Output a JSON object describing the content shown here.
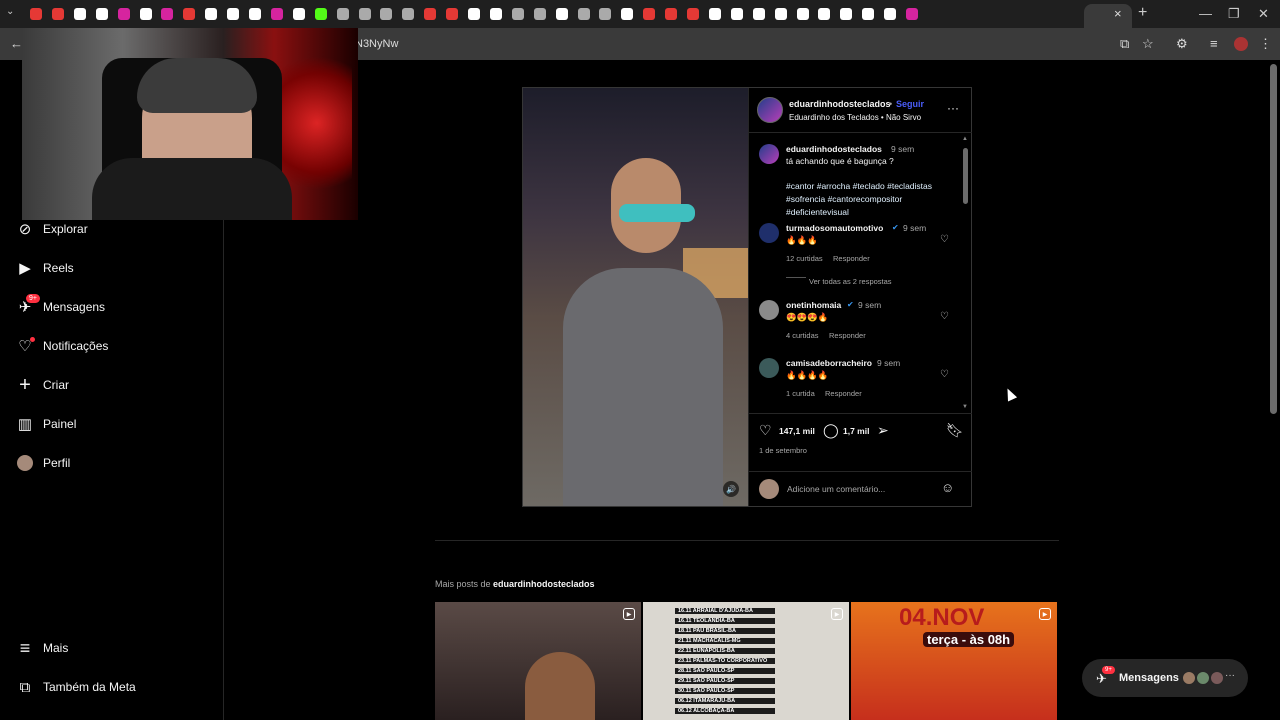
{
  "browser": {
    "url": "N3NyNw",
    "tab_menu": "⌄",
    "new_tab": "+",
    "tab_close": "×",
    "window_controls": [
      "—",
      "❐",
      "✕"
    ],
    "tab_favicons": [
      "#e53935",
      "#e53935",
      "#ffffff",
      "#ffffff",
      "#d6249f",
      "#ffffff",
      "#d6249f",
      "#e53935",
      "#ffffff",
      "#ffffff",
      "#ffffff",
      "#d6249f",
      "#ffffff",
      "#53fc18",
      "#aaaaaa",
      "#aaaaaa",
      "#aaaaaa",
      "#aaaaaa",
      "#e53935",
      "#e53935",
      "#ffffff",
      "#ffffff",
      "#aaaaaa",
      "#aaaaaa",
      "#ffffff",
      "#aaaaaa",
      "#aaaaaa",
      "#ffffff",
      "#e53935",
      "#e53935",
      "#e53935",
      "#ffffff",
      "#ffffff",
      "#ffffff",
      "#ffffff",
      "#ffffff",
      "#ffffff",
      "#ffffff",
      "#ffffff",
      "#ffffff",
      "#d6249f"
    ]
  },
  "sidebar": {
    "items": [
      {
        "icon": "compass-icon",
        "glyph": "⊘",
        "label": "Explorar"
      },
      {
        "icon": "reels-icon",
        "glyph": "▶",
        "label": "Reels"
      },
      {
        "icon": "messenger-icon",
        "glyph": "✈",
        "label": "Mensagens",
        "badge": "9+"
      },
      {
        "icon": "heart-icon",
        "glyph": "♡",
        "label": "Notificações"
      },
      {
        "icon": "plus-icon",
        "glyph": "+",
        "label": "Criar"
      },
      {
        "icon": "dashboard-icon",
        "glyph": "▥",
        "label": "Painel"
      },
      {
        "icon": "profile-avatar",
        "glyph": "",
        "label": "Perfil"
      }
    ],
    "more": {
      "glyph": "≡",
      "label": "Mais"
    },
    "meta": {
      "glyph": "⧉",
      "label": "Também da Meta"
    }
  },
  "post": {
    "username": "eduardinhodosteclados",
    "separator": "•",
    "follow": "Seguir",
    "audio": "Eduardinho dos Teclados • Não Sirvo",
    "more": "···",
    "sound_icon": "🔊",
    "caption": {
      "user": "eduardinhodosteclados",
      "time": "9 sem",
      "text": "tá achando que é bagunça ?",
      "tags": "#cantor #arrocha #teclado #tecladistas #sofrencia #cantorecompositor #deficientevisual"
    },
    "comments": [
      {
        "user": "turmadosomautomotivo",
        "verified": true,
        "time": "9 sem",
        "text": "🔥🔥🔥",
        "likes": "12 curtidas",
        "reply": "Responder",
        "replies": "Ver todas as 2 respostas",
        "avatar_color": "#1f2f6b"
      },
      {
        "user": "onetinhomaia",
        "verified": true,
        "time": "9 sem",
        "text": "😍😍😍🔥",
        "likes": "4 curtidas",
        "reply": "Responder",
        "avatar_color": "#8a8a8a"
      },
      {
        "user": "camisadeborracheiro",
        "verified": false,
        "time": "9 sem",
        "text": "🔥🔥🔥🔥",
        "likes": "1 curtida",
        "reply": "Responder",
        "avatar_color": "#3b5a5a"
      }
    ],
    "likes": "147,1 mil",
    "comment_count": "1,7 mil",
    "date": "1 de setembro",
    "comment_placeholder": "Adicione um comentário...",
    "emoji_icon": "☺"
  },
  "more_posts": {
    "prefix": "Mais posts de",
    "user": "eduardinhodosteclados",
    "tour_dates": [
      "16.11 ARRAIAL D'AJUDA-BA",
      "16.11 TEOLANDIA-BA",
      "18.11 PAU BRASIL-BA",
      "21.11 MACHACALIS-MG",
      "22.11 EUNAPOLIS-BA",
      "23.11 PALMAS-TO CORPORATIVO",
      "28.11 SAO PAULO-SP",
      "29.11 SAO PAULO-SP",
      "30.11 SAO PAULO-SP",
      "06.12 ITAMARAJU-BA",
      "06.12 ALCOBAÇA-BA"
    ],
    "poster_title": "04.NOV",
    "poster_subtitle": "terça - às 08h"
  },
  "messages_bar": {
    "label": "Mensagens",
    "badge": "9+",
    "more": "···",
    "avatar_colors": [
      "#9a7b64",
      "#6b8a6b",
      "#7a5a5a"
    ]
  }
}
